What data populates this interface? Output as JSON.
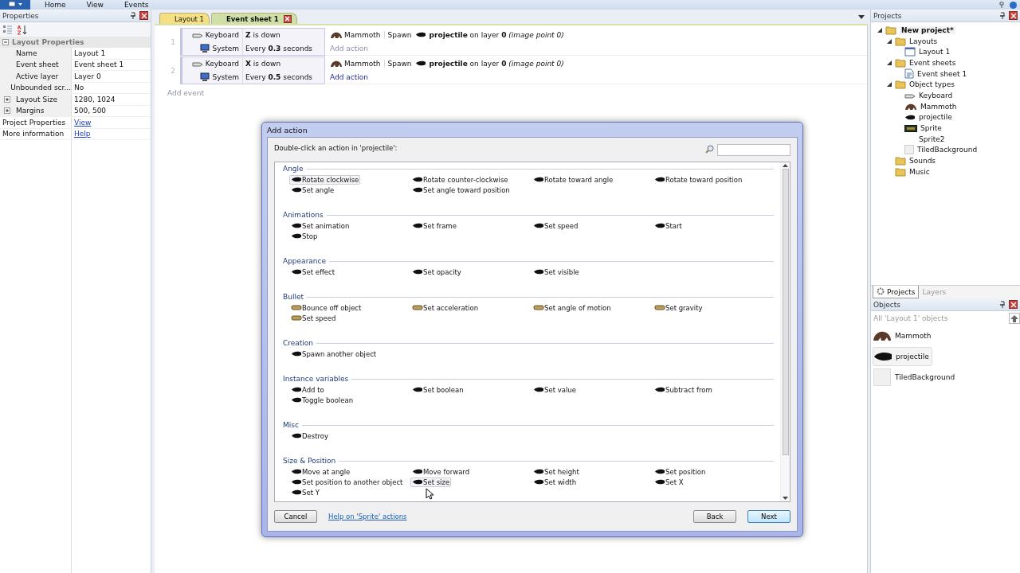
{
  "menu": [
    "Home",
    "View",
    "Events"
  ],
  "properties": {
    "title": "Properties",
    "group": {
      "label": "Layout Properties",
      "expanded": true
    },
    "rows": [
      {
        "kind": "prop",
        "name": "Name",
        "value": "Layout 1"
      },
      {
        "kind": "prop",
        "name": "Event sheet",
        "value": "Event sheet 1"
      },
      {
        "kind": "prop",
        "name": "Active layer",
        "value": "Layer 0"
      },
      {
        "kind": "prop",
        "name": "Unbounded scr...",
        "value": "No"
      },
      {
        "kind": "expandable",
        "name": "Layout Size",
        "value": "1280, 1024"
      },
      {
        "kind": "expandable",
        "name": "Margins",
        "value": "500, 500"
      },
      {
        "kind": "link",
        "name": "Project Properties",
        "value": "View"
      },
      {
        "kind": "link",
        "name": "More information",
        "value": "Help"
      }
    ]
  },
  "tabs": [
    {
      "label": "Layout 1",
      "selected": false,
      "closable": false
    },
    {
      "label": "Event sheet 1",
      "selected": true,
      "closable": true
    }
  ],
  "events": [
    {
      "number": "1",
      "conditions": [
        {
          "kind": "keyboard",
          "object": "Keyboard",
          "text": "**Z** is down"
        },
        {
          "kind": "system",
          "object": "System",
          "text": "Every **0.3** seconds"
        }
      ],
      "actions": [
        {
          "object": "Mammoth",
          "verb": "Spawn",
          "text": "**projectile** on layer **0** *(image point 0)*"
        }
      ],
      "add_action": {
        "label": "Add action",
        "active": false
      }
    },
    {
      "number": "2",
      "conditions": [
        {
          "kind": "keyboard",
          "object": "Keyboard",
          "text": "**X** is down"
        },
        {
          "kind": "system",
          "object": "System",
          "text": "Every **0.5** seconds"
        }
      ],
      "actions": [
        {
          "object": "Mammoth",
          "verb": "Spawn",
          "text": "**projectile** on layer **0** *(image point 0)*"
        }
      ],
      "add_action": {
        "label": "Add action",
        "active": true
      }
    }
  ],
  "add_event": "Add event",
  "dialog": {
    "title": "Add action",
    "prompt": "Double-click an action in 'projectile':",
    "groups": [
      {
        "name": "Angle",
        "actions": [
          {
            "label": "Rotate clockwise",
            "kind": "object",
            "highlighted": true
          },
          {
            "label": "Rotate counter-clockwise",
            "kind": "object",
            "highlighted": false
          },
          {
            "label": "Rotate toward angle",
            "kind": "object",
            "highlighted": false
          },
          {
            "label": "Rotate toward position",
            "kind": "object",
            "highlighted": false
          },
          {
            "label": "Set angle",
            "kind": "object",
            "highlighted": false
          },
          {
            "label": "Set angle toward position",
            "kind": "object",
            "highlighted": false
          }
        ]
      },
      {
        "name": "Animations",
        "actions": [
          {
            "label": "Set animation",
            "kind": "object",
            "highlighted": false
          },
          {
            "label": "Set frame",
            "kind": "object",
            "highlighted": false
          },
          {
            "label": "Set speed",
            "kind": "object",
            "highlighted": false
          },
          {
            "label": "Start",
            "kind": "object",
            "highlighted": false
          },
          {
            "label": "Stop",
            "kind": "object",
            "highlighted": false
          }
        ]
      },
      {
        "name": "Appearance",
        "actions": [
          {
            "label": "Set effect",
            "kind": "object",
            "highlighted": false
          },
          {
            "label": "Set opacity",
            "kind": "object",
            "highlighted": false
          },
          {
            "label": "Set visible",
            "kind": "object",
            "highlighted": false
          }
        ]
      },
      {
        "name": "Bullet",
        "actions": [
          {
            "label": "Bounce off object",
            "kind": "behavior",
            "highlighted": false
          },
          {
            "label": "Set acceleration",
            "kind": "behavior",
            "highlighted": false
          },
          {
            "label": "Set angle of motion",
            "kind": "behavior",
            "highlighted": false
          },
          {
            "label": "Set gravity",
            "kind": "behavior",
            "highlighted": false
          },
          {
            "label": "Set speed",
            "kind": "behavior",
            "highlighted": false
          }
        ]
      },
      {
        "name": "Creation",
        "actions": [
          {
            "label": "Spawn another object",
            "kind": "object",
            "highlighted": false
          }
        ]
      },
      {
        "name": "Instance variables",
        "actions": [
          {
            "label": "Add to",
            "kind": "object",
            "highlighted": false
          },
          {
            "label": "Set boolean",
            "kind": "object",
            "highlighted": false
          },
          {
            "label": "Set value",
            "kind": "object",
            "highlighted": false
          },
          {
            "label": "Subtract from",
            "kind": "object",
            "highlighted": false
          },
          {
            "label": "Toggle boolean",
            "kind": "object",
            "highlighted": false
          }
        ]
      },
      {
        "name": "Misc",
        "actions": [
          {
            "label": "Destroy",
            "kind": "object",
            "highlighted": false
          }
        ]
      },
      {
        "name": "Size & Position",
        "actions": [
          {
            "label": "Move at angle",
            "kind": "object",
            "highlighted": false
          },
          {
            "label": "Move forward",
            "kind": "object",
            "highlighted": false
          },
          {
            "label": "Set height",
            "kind": "object",
            "highlighted": false
          },
          {
            "label": "Set position",
            "kind": "object",
            "highlighted": false
          },
          {
            "label": "Set position to another object",
            "kind": "object",
            "highlighted": false
          },
          {
            "label": "Set size",
            "kind": "object",
            "highlighted": true
          },
          {
            "label": "Set width",
            "kind": "object",
            "highlighted": false
          },
          {
            "label": "Set X",
            "kind": "object",
            "highlighted": false
          },
          {
            "label": "Set Y",
            "kind": "object",
            "highlighted": false
          }
        ]
      }
    ],
    "buttons": [
      {
        "label": "Cancel",
        "kind": "plain"
      },
      {
        "label": "Help on 'Sprite' actions",
        "kind": "link"
      },
      {
        "label": "Back",
        "kind": "plain"
      },
      {
        "label": "Next",
        "kind": "default"
      }
    ]
  },
  "projects": {
    "title": "Projects",
    "tree": [
      {
        "label": "New project*",
        "kind": "folder",
        "selected": true,
        "expanded": true,
        "children": [
          {
            "label": "Layouts",
            "kind": "folder",
            "selected": false,
            "expanded": true,
            "children": [
              {
                "label": "Layout 1",
                "kind": "layout",
                "selected": false
              }
            ]
          },
          {
            "label": "Event sheets",
            "kind": "folder",
            "selected": false,
            "expanded": true,
            "children": [
              {
                "label": "Event sheet 1",
                "kind": "sheet",
                "selected": false
              }
            ]
          },
          {
            "label": "Object types",
            "kind": "folder",
            "selected": false,
            "expanded": true,
            "children": [
              {
                "label": "Keyboard",
                "kind": "keyboard",
                "selected": false
              },
              {
                "label": "Mammoth",
                "kind": "mammoth",
                "selected": false
              },
              {
                "label": "projectile",
                "kind": "projectile",
                "selected": false
              },
              {
                "label": "Sprite",
                "kind": "sprite",
                "selected": false
              },
              {
                "label": "Sprite2",
                "kind": "none",
                "selected": false
              },
              {
                "label": "TiledBackground",
                "kind": "tiled",
                "selected": false
              }
            ]
          },
          {
            "label": "Sounds",
            "kind": "folder",
            "selected": false
          },
          {
            "label": "Music",
            "kind": "folder",
            "selected": false
          }
        ]
      }
    ]
  },
  "bottom_tabs": [
    {
      "label": "Projects",
      "selected": true
    },
    {
      "label": "Layers",
      "selected": false
    }
  ],
  "objects": {
    "title": "Objects",
    "filter": "All 'Layout 1' objects",
    "items": [
      {
        "label": "Mammoth",
        "kind": "mammoth",
        "selected": false
      },
      {
        "label": "projectile",
        "kind": "projectile",
        "selected": true
      },
      {
        "label": "TiledBackground",
        "kind": "tiled",
        "selected": false
      }
    ]
  }
}
